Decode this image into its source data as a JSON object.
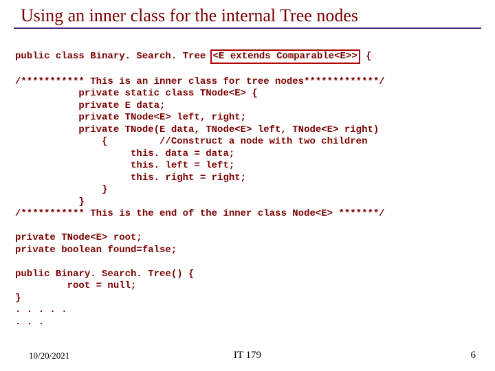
{
  "title": "Using an inner class for the internal Tree nodes",
  "code": {
    "l1a": "public class Binary. Search. Tree ",
    "l1b": "<E extends Comparable<E>>",
    "l1c": " {",
    "blank1": "",
    "l2": "/*********** This is an inner class for tree nodes*************/",
    "l3": "           private static class TNode<E> {",
    "l4": "           private E data;",
    "l5": "           private TNode<E> left, right;",
    "l6": "           private TNode(E data, TNode<E> left, TNode<E> right)",
    "l7": "               {         //Construct a node with two children",
    "l8": "                    this. data = data;",
    "l9": "                    this. left = left;",
    "l10": "                    this. right = right;",
    "l11": "               }",
    "l12": "           }",
    "l13": "/*********** This is the end of the inner class Node<E> *******/",
    "blank2": "",
    "l14": "private TNode<E> root;",
    "l15": "private boolean found=false;",
    "blank3": "",
    "l16": "public Binary. Search. Tree() {",
    "l17": "         root = null;",
    "l18": "}",
    "l19": ". . . . .",
    "l20": ". . ."
  },
  "footer": {
    "date": "10/20/2021",
    "course": "IT 179",
    "page": "6"
  }
}
